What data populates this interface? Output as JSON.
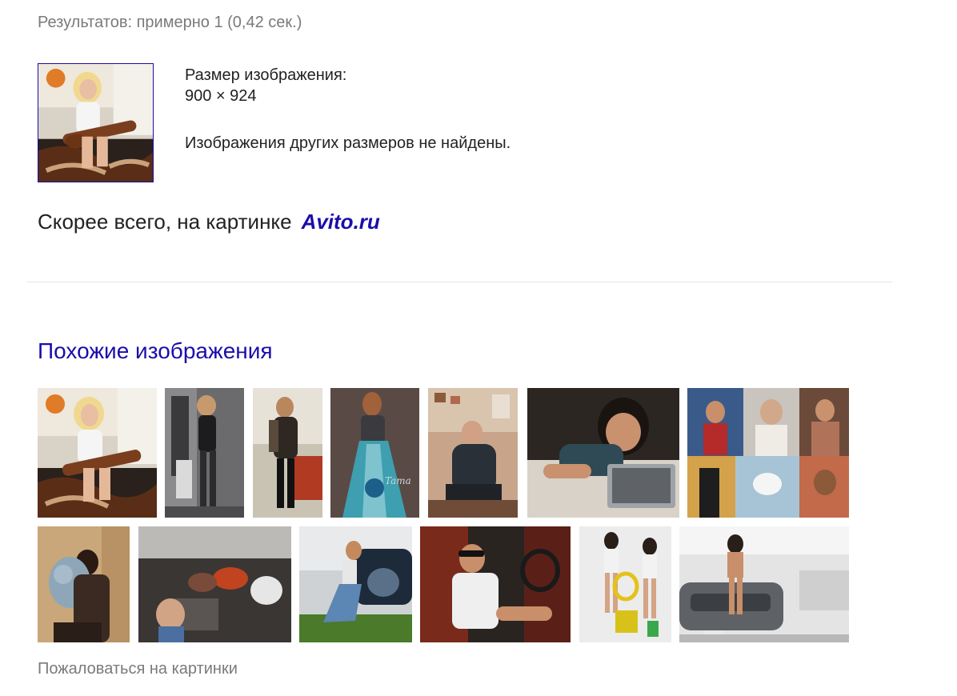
{
  "results_stats": "Результатов: примерно 1 (0,42 сек.)",
  "query_image": {
    "icon": "query-photo-thumbnail"
  },
  "image_info": {
    "size_label": "Размер изображения:",
    "size_value": "900 × 924",
    "other_sizes": "Изображения других размеров не найдены."
  },
  "best_guess": {
    "prefix": "Скорее всего, на картинке",
    "link_text": "Avito.ru"
  },
  "similar": {
    "heading": "Похожие изображения",
    "row1": [
      "similar-photo-1",
      "similar-photo-2",
      "similar-photo-3",
      "similar-photo-4",
      "similar-photo-5",
      "similar-photo-6",
      "similar-photo-7"
    ],
    "row2": [
      "similar-photo-8",
      "similar-photo-9",
      "similar-photo-10",
      "similar-photo-11",
      "similar-photo-12",
      "similar-photo-13"
    ]
  },
  "report_link": "Пожаловаться на картинки",
  "colors": {
    "link": "#1a0dab",
    "muted": "#7a7a7a",
    "text": "#222222"
  }
}
